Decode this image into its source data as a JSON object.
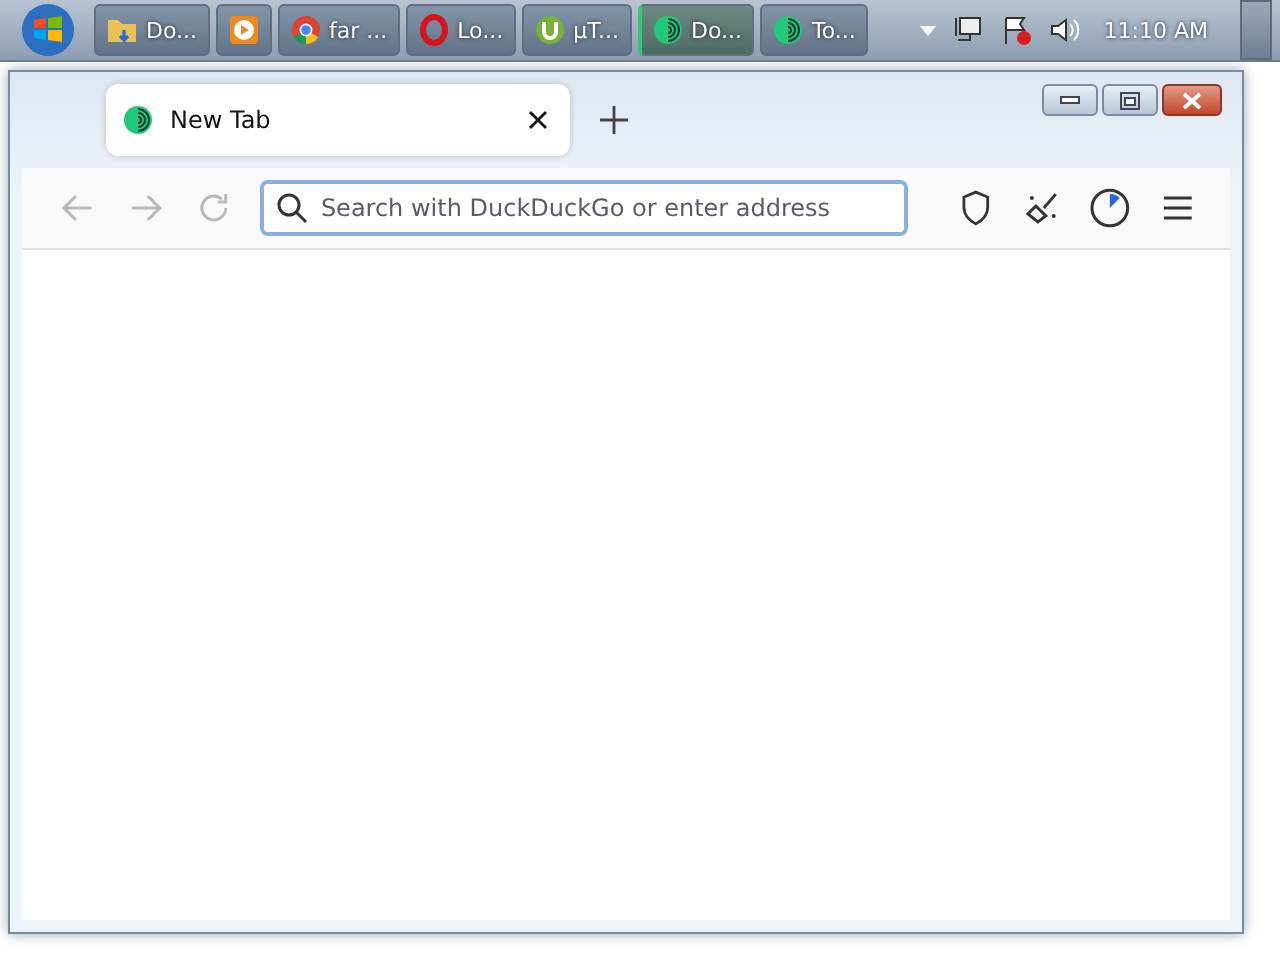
{
  "taskbar": {
    "buttons": [
      {
        "kind": "folder",
        "label": "Do...",
        "selected": false
      },
      {
        "kind": "media",
        "selected": false
      },
      {
        "kind": "chrome",
        "label": "far ...",
        "selected": false
      },
      {
        "kind": "opera",
        "label": "Lo...",
        "selected": false
      },
      {
        "kind": "torrent",
        "label": "µT...",
        "selected": false
      },
      {
        "kind": "onion",
        "label": "Do...",
        "selected": true
      },
      {
        "kind": "onion",
        "label": "To...",
        "selected": false
      }
    ],
    "clock": "11:10 AM"
  },
  "browser": {
    "tabs": [
      {
        "title": "New Tab",
        "selected": true
      }
    ],
    "address_bar": {
      "placeholder": "Search with DuckDuckGo or enter address"
    }
  }
}
